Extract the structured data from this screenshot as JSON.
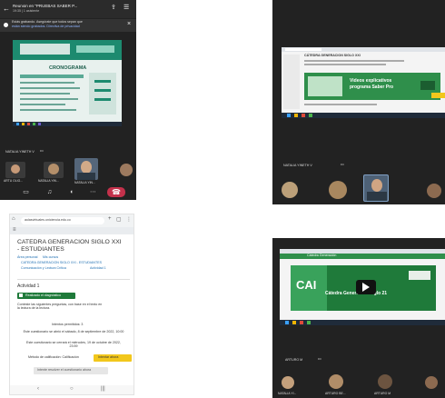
{
  "q1": {
    "status_time": "19:35",
    "meeting_title": "Reunión en \"PRUEBAS SABER P...",
    "meeting_subtitle": "19:35 | 1 asistente",
    "banner_line1": "Estás grabando. Asegúrate que todos sepan que",
    "banner_line2": "están siendo grabados. Directiva de privacidad",
    "slide_title": "CRONOGRAMA",
    "speaker_name": "NATALIA YINETH V",
    "thumbs": [
      {
        "name": "ARTU OLIG..."
      },
      {
        "name": "NATALIA YIN..."
      },
      {
        "name": "NATALIA YIN..."
      }
    ]
  },
  "q2": {
    "page_heading": "CÁTEDRA GENERACION SIGLO XXI",
    "banner_title_1": "Videos explicativos",
    "banner_title_2": "programa Saber Pro",
    "speaker_name": "NATALIA YINETH V"
  },
  "q3": {
    "url": "aulasvirtuales.uniciencia.edu.co",
    "course_title_1": "CATEDRA GENERACION SIGLO XXI",
    "course_title_2": "- ESTUDIANTES",
    "breadcrumb_1": "Área personal",
    "breadcrumb_2": "Mis cursos",
    "breadcrumb_3": "CATEDRA GENERACION SIGLO XXI - ESTUDIANTES",
    "breadcrumb_4": "Comunicación y Lectura Crítica",
    "breadcrumb_5": "Actividad 1",
    "activity_title": "Actividad 1",
    "done_badge": "Realizado el diagnóstico",
    "instructions": "Conteste las siguientes preguntas, con base en el texto en la lectura de la lectura.",
    "attempts": "Intentos permitidos: 3",
    "opened": "Este cuestionario se abrió el sábado, 8 de septiembre de 2022, 10:00",
    "closes": "Este cuestionario se cerrará el miércoles, 19 de octubre de 2022, 23:59",
    "grading": "Método de calificación: Calificación",
    "attempt_button": "Intente resolver el cuestionario ahora",
    "start_button": "Intentar ahora"
  },
  "q4": {
    "banner_small": "Cátedra Generación",
    "cai_label": "CAI",
    "video_title": "Cátedra Generación Siglo 21",
    "speaker_name": "ARTURO M",
    "thumbs": [
      {
        "name": "NATALIA YI..."
      },
      {
        "name": "ARTURO BE..."
      },
      {
        "name": "ARTURO M"
      },
      {
        "name": ""
      }
    ]
  },
  "colors": {
    "teams_dark": "#222222",
    "hangup_red": "#c4314b",
    "moodle_green": "#1f7a3a",
    "accent_yellow": "#f2c71c"
  }
}
